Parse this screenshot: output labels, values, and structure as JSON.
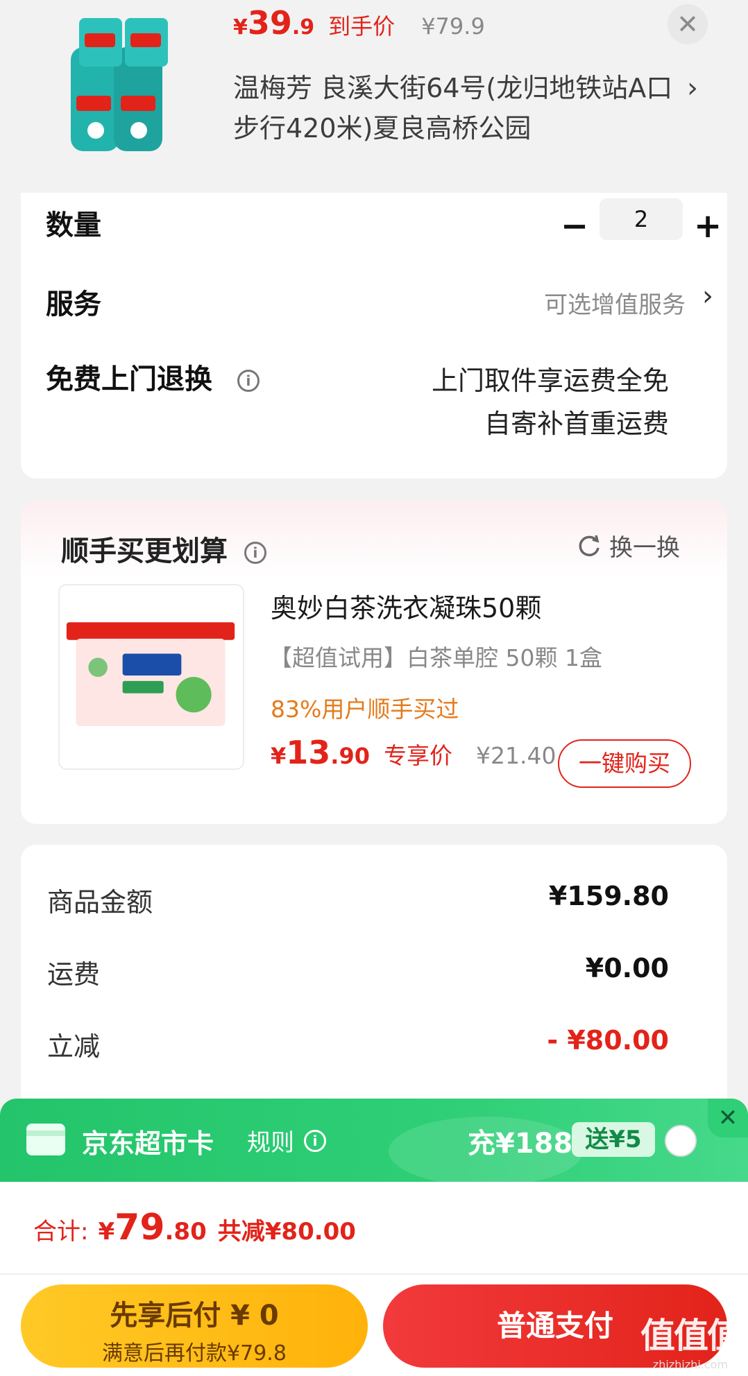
{
  "product": {
    "image_alt": "Liby laundry detergent bottles",
    "price_currency": "¥",
    "price_int": "39",
    "price_dec": ".9",
    "price_tag": "到手价",
    "orig_price": "¥79.9",
    "address": "温梅芳  良溪大街64号(龙归地铁站A口步行420米)夏良高桥公园",
    "close_icon": "close-icon"
  },
  "details": {
    "quantity_label": "数量",
    "quantity_value": "2",
    "minus": "−",
    "plus": "+",
    "service_label": "服务",
    "service_value": "可选增值服务",
    "return_label": "免费上门退换",
    "return_line1": "上门取件享运费全免",
    "return_line2": "自寄补首重运费",
    "chevron": "›",
    "info": "i"
  },
  "recommend": {
    "title": "顺手买更划算",
    "refresh_label": "换一换",
    "item_name": "奥妙白茶洗衣凝珠50颗",
    "item_spec": "【超值试用】白茶单腔  50颗 1盒",
    "item_percent": "83%用户顺手买过",
    "price_currency": "¥",
    "price_int": "13",
    "price_dec": ".90",
    "price_tag": "专享价",
    "orig_price": "¥21.40",
    "buy_label": "一键购买"
  },
  "summary": {
    "goods_label": "商品金额",
    "goods_value": "¥159.80",
    "shipping_label": "运费",
    "shipping_value": "¥0.00",
    "discount_label": "立减",
    "discount_value": "- ¥80.00"
  },
  "supermarket_card": {
    "title": "京东超市卡",
    "rule_label": "规则",
    "amount": "充¥188",
    "gift": "送¥5",
    "close": "✕"
  },
  "total": {
    "label": "合计:",
    "currency": "¥",
    "int": "79",
    "dec": ".80",
    "discount": "共减¥80.00"
  },
  "actions": {
    "later_line1": "先享后付 ¥ 0",
    "later_line2": "满意后再付款¥79.8",
    "pay_label": "普通支付"
  },
  "watermark": {
    "main": "值值值",
    "sub": "zhizhizhi.com"
  },
  "colors": {
    "accent_red": "#e2231a",
    "green": "#2ecf76",
    "yellow": "#ffc926"
  }
}
